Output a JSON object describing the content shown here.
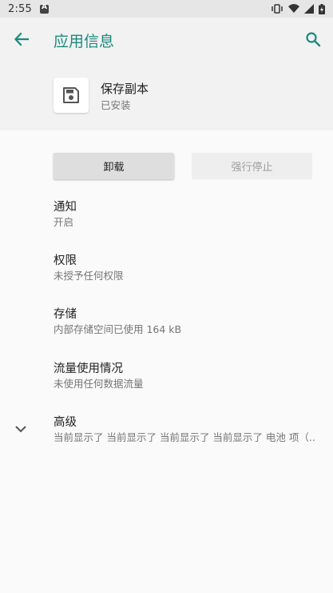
{
  "status_bar": {
    "time": "2:55"
  },
  "app_bar": {
    "title": "应用信息",
    "back_icon": "arrow-back-icon",
    "search_icon": "search-icon"
  },
  "app": {
    "name": "保存副本",
    "status": "已安装",
    "icon": "save-icon"
  },
  "buttons": {
    "uninstall": "卸载",
    "force_stop": "强行停止"
  },
  "prefs": [
    {
      "title": "通知",
      "summary": "开启"
    },
    {
      "title": "权限",
      "summary": "未授予任何权限"
    },
    {
      "title": "存储",
      "summary": "内部存储空间已使用 164 kB"
    },
    {
      "title": "流量使用情况",
      "summary": "未使用任何数据流量"
    }
  ],
  "advanced": {
    "title": "高级",
    "summary": "当前显示了 当前显示了 当前显示了 当前显示了 电池 项（..",
    "icon": "chevron-down-icon"
  },
  "colors": {
    "accent": "#1a8a7e",
    "background": "#fafafa",
    "header": "#f2f2f2"
  }
}
